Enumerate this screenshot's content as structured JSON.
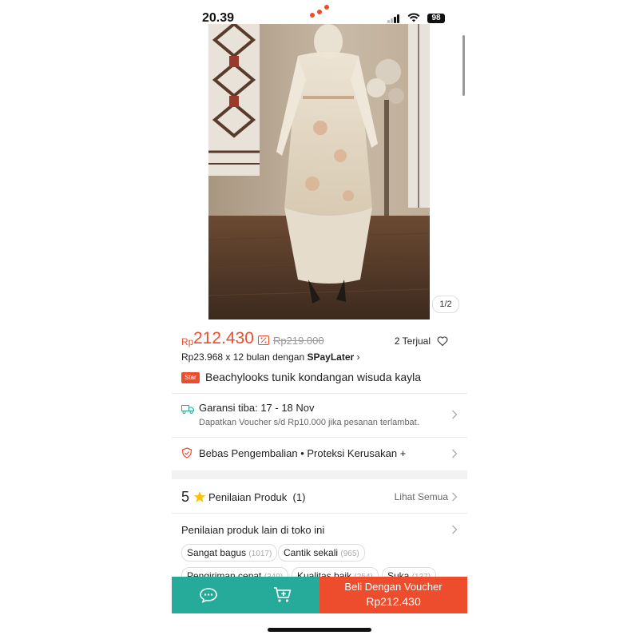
{
  "status_bar": {
    "time": "20.39",
    "battery": "98"
  },
  "gallery": {
    "page_indicator": "1/2"
  },
  "product": {
    "currency": "Rp",
    "price": "212.430",
    "original_price": "Rp219.000",
    "sold_count": "2 Terjual",
    "installment_prefix": "Rp23.968 x 12 bulan dengan ",
    "installment_brand": "SPayLater",
    "installment_chevron": "›",
    "badge": "Star",
    "title": "Beachylooks tunik kondangan wisuda kayla"
  },
  "shipping": {
    "title": "Garansi tiba: 17 - 18 Nov",
    "subtitle": "Dapatkan Voucher s/d Rp10.000 jika pesanan terlambat."
  },
  "returns": {
    "text": "Bebas Pengembalian  •  Proteksi Kerusakan +"
  },
  "rating": {
    "score": "5",
    "label": "Penilaian Produk",
    "count": "(1)",
    "see_all": "Lihat Semua"
  },
  "store_reviews": {
    "label": "Penilaian produk lain di toko ini",
    "chips": [
      {
        "label": "Sangat bagus",
        "count": "(1017)"
      },
      {
        "label": "Cantik sekali",
        "count": "(965)"
      },
      {
        "label": "Pengiriman cepat",
        "count": "(349)"
      },
      {
        "label": "Kualitas baik",
        "count": "(254)"
      },
      {
        "label": "Suka",
        "count": "(137)"
      }
    ]
  },
  "bottom_bar": {
    "chat_icon": "chat-icon",
    "cart_icon": "add-to-cart-icon",
    "buy_label": "Beli Dengan Voucher",
    "buy_price": "Rp212.430"
  },
  "colors": {
    "brand": "#ee4d2d",
    "teal": "#26aa99"
  }
}
